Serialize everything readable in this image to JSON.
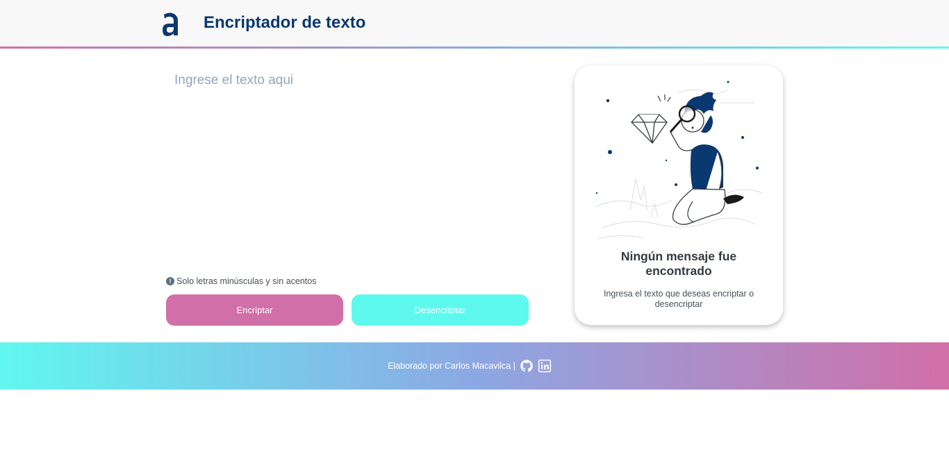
{
  "header": {
    "logo_icon": "alura-logo-icon",
    "title": "Encriptador de texto",
    "accent_color": "#0a3871"
  },
  "input": {
    "placeholder": "Ingrese el texto aqui",
    "value": ""
  },
  "hint": {
    "icon": "exclamation-circle-icon",
    "text": "Solo letras minúsculas y sin acentos"
  },
  "buttons": {
    "encrypt_label": "Encriptar",
    "decrypt_label": "Desencriptar",
    "encrypt_color": "#d16fa8",
    "decrypt_color": "#5ef9ee"
  },
  "output_card": {
    "illustration": "person-with-magnifying-glass-illustration",
    "title": "Ningún mensaje fue encontrado",
    "subtitle": "Ingresa el texto que deseas encriptar o desencriptar"
  },
  "footer": {
    "credit": "Elaborado por Carlos Macavilca |",
    "icons": [
      "github-icon",
      "linkedin-icon"
    ]
  }
}
